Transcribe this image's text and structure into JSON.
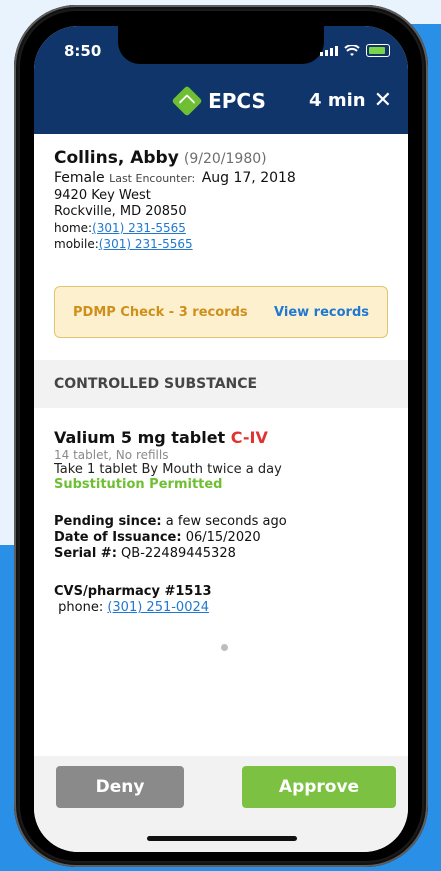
{
  "status": {
    "time": "8:50"
  },
  "header": {
    "title": "EPCS",
    "timer": "4 min",
    "close_symbol": "✕"
  },
  "patient": {
    "name": "Collins, Abby",
    "dob": "(9/20/1980)",
    "sex": "Female",
    "last_encounter_label": "Last Encounter:",
    "last_encounter_date": "Aug 17, 2018",
    "address_line1": "9420 Key West",
    "address_line2": "Rockville, MD 20850",
    "home_label": "home:",
    "home_phone": "(301) 231-5565",
    "mobile_label": "mobile:",
    "mobile_phone": "(301) 231-5565"
  },
  "pdmp": {
    "label": "PDMP Check - 3 records",
    "action": "View records"
  },
  "section": {
    "title": "CONTROLLED SUBSTANCE"
  },
  "drug": {
    "name": "Valium 5 mg tablet",
    "schedule": "C-IV",
    "quantity": "14 tablet, No refills",
    "directions": "Take 1 tablet By Mouth twice a day",
    "substitution": "Substitution Permitted"
  },
  "details": {
    "pending_label": "Pending since:",
    "pending_value": "a few seconds ago",
    "issuance_label": "Date of Issuance:",
    "issuance_value": "06/15/2020",
    "serial_label": "Serial #:",
    "serial_value": "QB-22489445328"
  },
  "pharmacy": {
    "name": "CVS/pharmacy #1513",
    "phone_label": "phone:",
    "phone": "(301) 251-0024"
  },
  "actions": {
    "deny": "Deny",
    "approve": "Approve"
  },
  "colors": {
    "header_bg": "#10356a",
    "accent_green": "#7cc142",
    "link_blue": "#1f78d1",
    "schedule_red": "#e0322e",
    "pdmp_bg": "#fdf0cf"
  },
  "icons": {
    "brand": "epcs-diamond-icon",
    "close": "close-icon",
    "signal": "signal-icon",
    "wifi": "wifi-icon",
    "battery": "battery-icon"
  }
}
